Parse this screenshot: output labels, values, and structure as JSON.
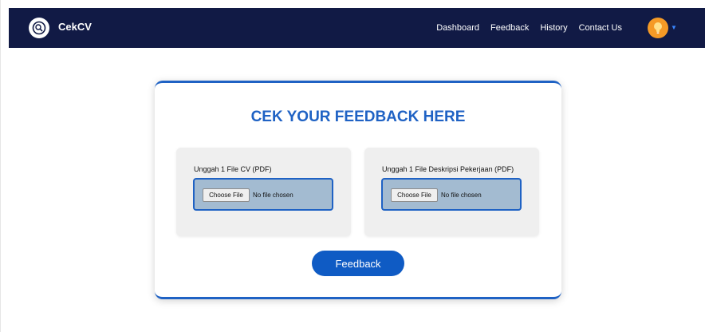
{
  "navbar": {
    "brand": "CekCV",
    "logo_icon": "magnifier-document-icon",
    "links": [
      "Dashboard",
      "Feedback",
      "History",
      "Contact Us"
    ],
    "avatar_icon": "lightbulb-icon",
    "avatar_color": "#f59a26",
    "background": "#111a45"
  },
  "card": {
    "title": "CEK YOUR FEEDBACK HERE",
    "accent": "#1f62c4",
    "uploads": [
      {
        "label": "Unggah 1 File CV (PDF)",
        "button": "Choose File",
        "status": "No file chosen"
      },
      {
        "label": "Unggah 1 File Deskripsi Pekerjaan (PDF)",
        "button": "Choose File",
        "status": "No file chosen"
      }
    ],
    "submit_label": "Feedback"
  }
}
